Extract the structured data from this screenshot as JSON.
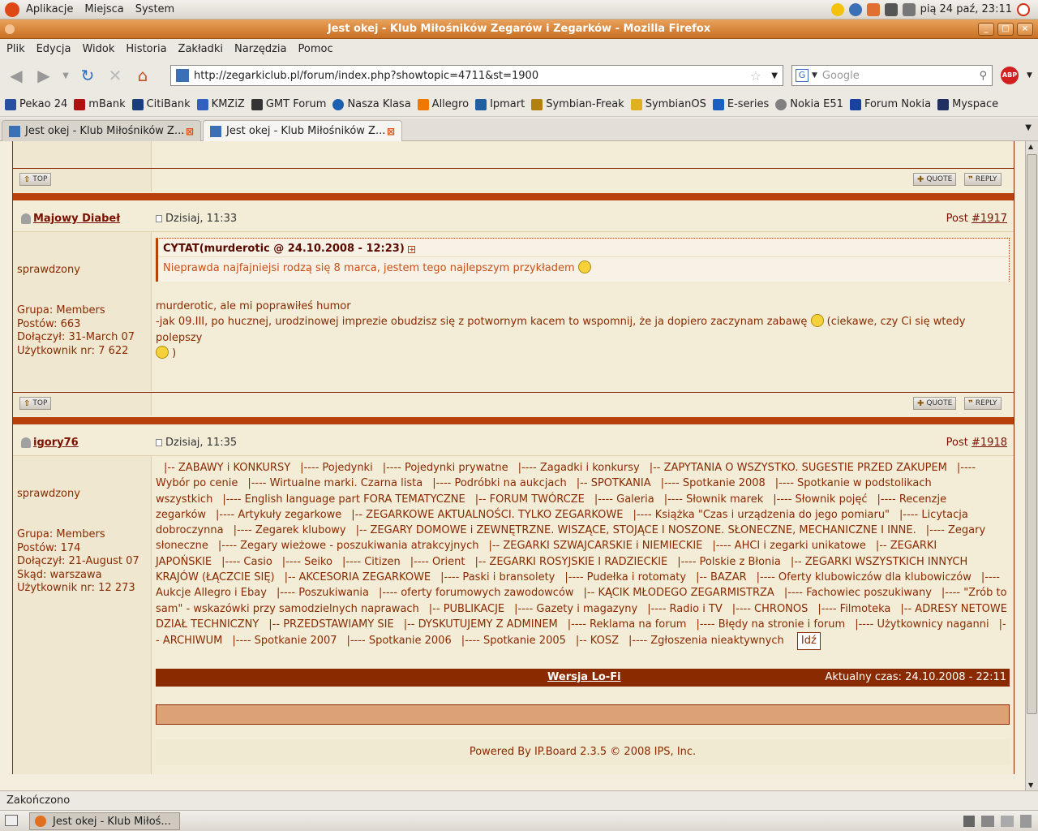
{
  "gnome": {
    "menus": [
      "Aplikacje",
      "Miejsca",
      "System"
    ],
    "clock": "pią 24 paź, 23:11"
  },
  "window": {
    "title": "Jest okej - Klub Miłośników Zegarów i Zegarków - Mozilla Firefox"
  },
  "menubar": [
    "Plik",
    "Edycja",
    "Widok",
    "Historia",
    "Zakładki",
    "Narzędzia",
    "Pomoc"
  ],
  "navbar": {
    "url": "http://zegarkiclub.pl/forum/index.php?showtopic=4711&st=1900",
    "search_placeholder": "Google"
  },
  "bookmarks": [
    {
      "label": "Pekao 24",
      "color": "#2850a0"
    },
    {
      "label": "mBank",
      "color": "#b01010"
    },
    {
      "label": "CitiBank",
      "color": "#1a3d80"
    },
    {
      "label": "KMZiZ",
      "color": "#3060c0"
    },
    {
      "label": "GMT Forum",
      "color": "#333333"
    },
    {
      "label": "Nasza Klasa",
      "color": "#1a5fb0"
    },
    {
      "label": "Allegro",
      "color": "#f07800"
    },
    {
      "label": "Ipmart",
      "color": "#2060a0"
    },
    {
      "label": "Symbian-Freak",
      "color": "#b08010"
    },
    {
      "label": "SymbianOS",
      "color": "#e0b020"
    },
    {
      "label": "E-series",
      "color": "#1a60c0"
    },
    {
      "label": "Nokia E51",
      "color": "#808080"
    },
    {
      "label": "Forum Nokia",
      "color": "#1a40a0"
    },
    {
      "label": "Myspace",
      "color": "#203060"
    }
  ],
  "tabs": [
    {
      "label": "Jest okej - Klub Miłośników Z..."
    },
    {
      "label": "Jest okej - Klub Miłośników Z..."
    }
  ],
  "forum": {
    "top_label": "TOP",
    "quote_label": "QUOTE",
    "reply_label": "REPLY",
    "post1": {
      "author": "Majowy Diabeł",
      "date": "Dzisiaj, 11:33",
      "post_prefix": "Post ",
      "post_no": "#1917",
      "rank": "sprawdzony",
      "group": "Grupa: Members",
      "posts": "Postów: 663",
      "joined": "Dołączył: 31-March 07",
      "user_no": "Użytkownik nr: 7 622",
      "quote_header": "CYTAT(murderotic @ 24.10.2008 - 12:23)",
      "quote_body": "Nieprawda najfajniejsi rodzą się 8 marca, jestem tego najlepszym przykładem",
      "body_line1": "murderotic, ale mi poprawiłeś humor",
      "body_line2": "-jak 09.III, po hucznej, urodzinowej imprezie obudzisz się z potwornym kacem to wspomnij, że ja dopiero zaczynam zabawę",
      "body_line2b": "(ciekawe, czy Ci się wtedy polepszy",
      "body_line3": ")"
    },
    "post2": {
      "author": "igory76",
      "date": "Dzisiaj, 11:35",
      "post_prefix": "Post ",
      "post_no": "#1918",
      "rank": "sprawdzony",
      "group": "Grupa: Members",
      "posts": "Postów: 174",
      "joined": "Dołączył: 21-August 07",
      "location": "Skąd: warszawa",
      "user_no": "Użytkownik nr: 12 273"
    },
    "jump_items": [
      "|-- ZABAWY i KONKURSY",
      "|---- Pojedynki",
      "|---- Pojedynki prywatne",
      "|---- Zagadki i konkursy",
      "|-- ZAPYTANIA O WSZYSTKO. SUGESTIE PRZED ZAKUPEM",
      "|---- Wybór po cenie",
      "|---- Wirtualne marki. Czarna lista",
      "|---- Podróbki na aukcjach",
      "|-- SPOTKANIA",
      "|---- Spotkanie 2008",
      "|---- Spotkanie w podstolikach wszystkich",
      "|---- English language part FORA TEMATYCZNE",
      "|-- FORUM TWÓRCZE",
      "|---- Galeria",
      "|---- Słownik marek",
      "|---- Słownik pojęć",
      "|---- Recenzje zegarków",
      "|---- Artykuły zegarkowe",
      "|-- ZEGARKOWE AKTUALNOŚCI. TYLKO ZEGARKOWE",
      "|---- Książka \"Czas i urządzenia do jego pomiaru\"",
      "|---- Licytacja dobroczynna",
      "|---- Zegarek klubowy",
      "|-- ZEGARY DOMOWE i ZEWNĘTRZNE. WISZĄCE, STOJĄCE I NOSZONE. SŁONECZNE, MECHANICZNE I INNE.",
      "|---- Zegary słoneczne",
      "|---- Zegary wieżowe - poszukiwania atrakcyjnych",
      "|-- ZEGARKI SZWAJCARSKIE i NIEMIECKIE",
      "|---- AHCI i zegarki unikatowe",
      "|-- ZEGARKI JAPOŃSKIE",
      "|---- Casio",
      "|---- Seiko",
      "|---- Citizen",
      "|---- Orient",
      "|-- ZEGARKI ROSYJSKIE I RADZIECKIE",
      "|---- Polskie z Błonia",
      "|-- ZEGARKI WSZYSTKICH INNYCH KRAJÓW (ŁĄCZCIE SIĘ)",
      "|-- AKCESORIA ZEGARKOWE",
      "|---- Paski i bransolety",
      "|---- Pudełka i rotomaty",
      "|-- BAZAR",
      "|---- Oferty klubowiczów dla klubowiczów",
      "|---- Aukcje Allegro i Ebay",
      "|---- Poszukiwania",
      "|---- oferty forumowych zawodowców",
      "|-- KĄCIK MŁODEGO ZEGARMISTRZA",
      "|---- Fachowiec poszukiwany",
      "|---- \"Zrób to sam\" - wskazówki przy samodzielnych naprawach",
      "|-- PUBLIKACJE",
      "|---- Gazety i magazyny",
      "|---- Radio i TV",
      "|---- CHRONOS",
      "|---- Filmoteka",
      "|-- ADRESY NETOWE DZIAŁ TECHNICZNY",
      "|-- PRZEDSTAWIAMY SIE",
      "|-- DYSKUTUJEMY Z ADMINEM",
      "|---- Reklama na forum",
      "|---- Błędy na stronie i forum",
      "|---- Użytkownicy naganni",
      "|-- ARCHIWUM",
      "|---- Spotkanie 2007",
      "|---- Spotkanie 2006",
      "|---- Spotkanie 2005",
      "|-- KOSZ",
      "|---- Zgłoszenia nieaktywnych"
    ],
    "go_label": "Idź",
    "lofi": "Wersja Lo-Fi",
    "time": "Aktualny czas: 24.10.2008 - 22:11",
    "powered": "Powered By IP.Board 2.3.5 © 2008  IPS, Inc."
  },
  "status": "Zakończono",
  "taskbar": {
    "item": "Jest okej - Klub Miłoś..."
  }
}
